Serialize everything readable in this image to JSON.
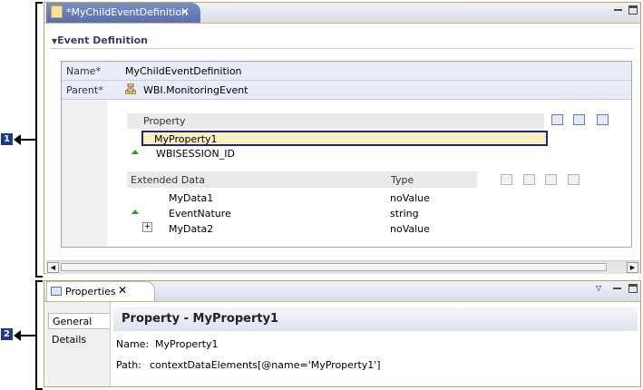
{
  "callouts": [
    "1",
    "2"
  ],
  "editor": {
    "tab_title": "*MyChildEventDefinition",
    "tab_close": "✕",
    "section_title": "Event Definition",
    "form": {
      "name_label": "Name*",
      "name_value": "MyChildEventDefinition",
      "parent_label": "Parent*",
      "parent_value": "WBI.MonitoringEvent"
    },
    "property_table": {
      "header": "Property",
      "selected": "MyProperty1",
      "rows": [
        "WBISESSION_ID"
      ]
    },
    "extended_data": {
      "headers": [
        "Extended Data",
        "Type"
      ],
      "rows": [
        {
          "name": "MyData1",
          "type": "noValue"
        },
        {
          "name": "EventNature",
          "type": "string"
        },
        {
          "name": "MyData2",
          "type": "noValue"
        }
      ],
      "expander": "+"
    },
    "scroll_left": "◀",
    "scroll_right": "▶"
  },
  "properties": {
    "tab_title": "Properties",
    "tab_close": "✕",
    "tabs": [
      "General",
      "Details"
    ],
    "header": "Property - MyProperty1",
    "name_label": "Name:",
    "name_value": "MyProperty1",
    "path_label": "Path:",
    "path_value": "contextDataElements[@name='MyProperty1']"
  },
  "colors": {
    "accent": "#5870b0",
    "callout_badge": "#1a3a8a",
    "selection_fill": "#fcefc4",
    "frame": "#b8a65a"
  }
}
